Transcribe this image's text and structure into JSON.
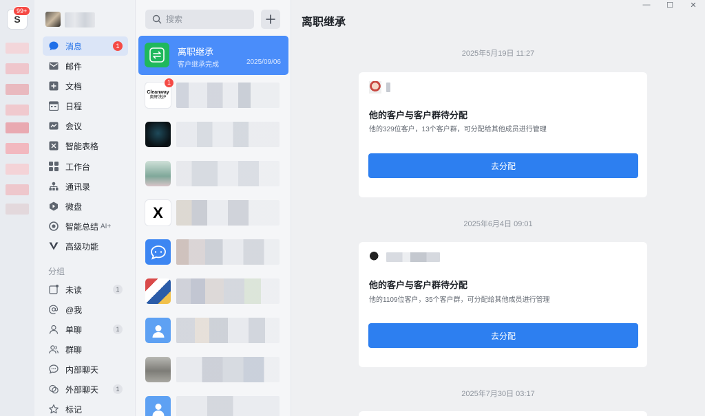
{
  "colors": {
    "accent": "#2d7ff0",
    "active_row": "#4a8dfa",
    "badge": "#f54a45",
    "inherit_icon": "#1fb85c"
  },
  "workspace": {
    "logo_letter": "S",
    "badge": "99+"
  },
  "nav": {
    "items": [
      {
        "label": "消息",
        "icon": "message-icon",
        "badge": "1",
        "active": true
      },
      {
        "label": "邮件",
        "icon": "mail-icon"
      },
      {
        "label": "文档",
        "icon": "docs-icon"
      },
      {
        "label": "日程",
        "icon": "calendar-icon"
      },
      {
        "label": "会议",
        "icon": "meeting-icon"
      },
      {
        "label": "智能表格",
        "icon": "smart-sheet-icon"
      },
      {
        "label": "工作台",
        "icon": "workbench-icon"
      },
      {
        "label": "通讯录",
        "icon": "contacts-icon"
      },
      {
        "label": "微盘",
        "icon": "drive-icon"
      },
      {
        "label": "智能总结",
        "tag": "AI+",
        "icon": "ai-summary-icon"
      },
      {
        "label": "高级功能",
        "icon": "premium-icon"
      }
    ],
    "group_header": "分组",
    "groups": [
      {
        "label": "未读",
        "icon": "unread-icon",
        "badge": "1"
      },
      {
        "label": "@我",
        "icon": "at-icon"
      },
      {
        "label": "单聊",
        "icon": "single-chat-icon",
        "badge": "1"
      },
      {
        "label": "群聊",
        "icon": "group-chat-icon"
      },
      {
        "label": "内部聊天",
        "icon": "internal-chat-icon"
      },
      {
        "label": "外部聊天",
        "icon": "external-chat-icon",
        "badge": "1"
      },
      {
        "label": "标记",
        "icon": "star-icon"
      }
    ]
  },
  "search": {
    "placeholder": "搜索"
  },
  "conversations": {
    "active": {
      "title": "离职继承",
      "subtitle": "客户继承完成",
      "date": "2025/09/06",
      "icon": "inherit-icon"
    },
    "others": [
      {
        "avatar_text": "Cleanway",
        "avatar_sub": "奥辉洗护",
        "badge": "1"
      },
      {
        "avatar_text": ""
      },
      {
        "avatar_text": ""
      },
      {
        "avatar_text": "X"
      },
      {
        "avatar_text": ""
      },
      {
        "avatar_text": ""
      },
      {
        "avatar_text": ""
      },
      {
        "avatar_text": ""
      },
      {
        "avatar_text": ""
      }
    ]
  },
  "chat": {
    "title": "离职继承",
    "messages": [
      {
        "time": "2025年5月19日 11:27",
        "title": "他的客户与客户群待分配",
        "desc": "他的329位客户，13个客户群，可分配给其他成员进行管理",
        "button": "去分配"
      },
      {
        "time": "2025年6月4日 09:01",
        "title": "他的客户与客户群待分配",
        "desc": "他的1109位客户，35个客户群，可分配给其他成员进行管理",
        "button": "去分配"
      },
      {
        "time": "2025年7月30日 03:17"
      }
    ]
  }
}
